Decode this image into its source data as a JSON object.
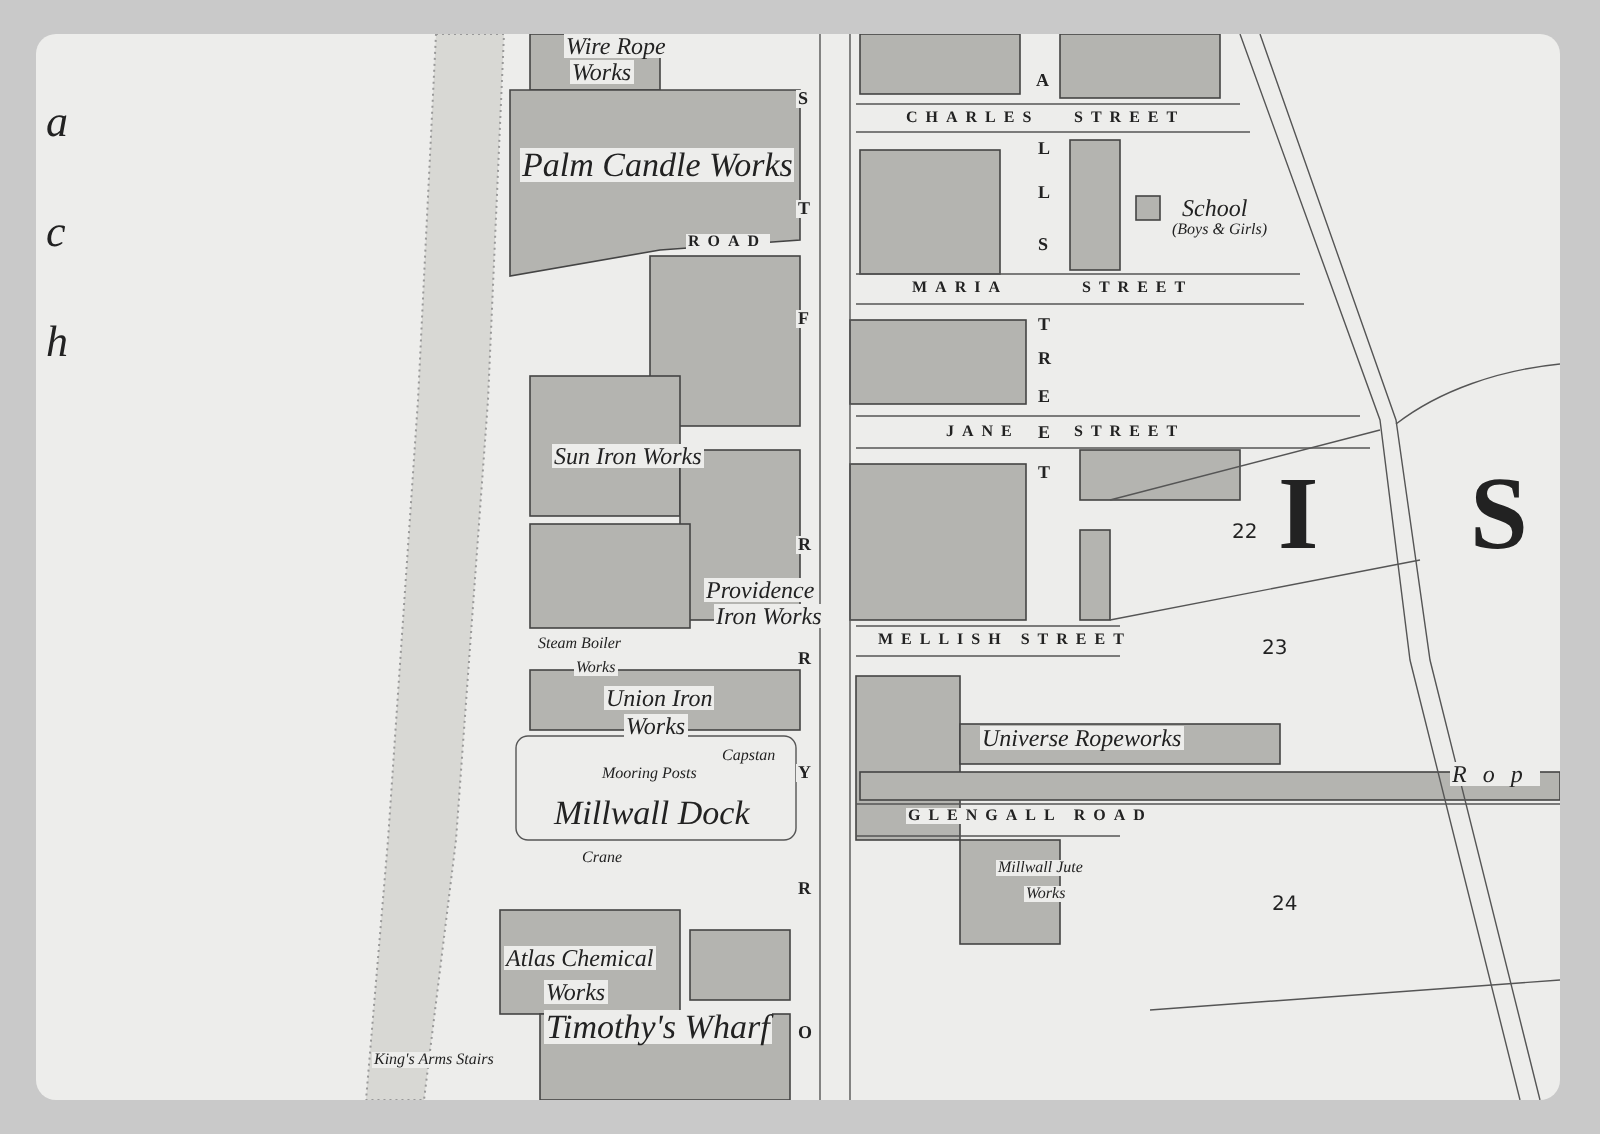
{
  "map": {
    "labels": [
      {
        "text": "a",
        "kind": "reach"
      },
      {
        "text": "c",
        "kind": "reach"
      },
      {
        "text": "h",
        "kind": "reach"
      },
      {
        "text": "Wire Rope",
        "kind": "works"
      },
      {
        "text": "Works",
        "kind": "works"
      },
      {
        "text": "S",
        "kind": "letter"
      },
      {
        "text": "A",
        "kind": "letter"
      },
      {
        "text": "CHARLES",
        "kind": "street"
      },
      {
        "text": "STREET",
        "kind": "street"
      },
      {
        "text": "Palm Candle Works",
        "kind": "works_large"
      },
      {
        "text": "L",
        "kind": "letter"
      },
      {
        "text": "L",
        "kind": "letter"
      },
      {
        "text": "School",
        "kind": "works"
      },
      {
        "text": "(Boys & Girls)",
        "kind": "note"
      },
      {
        "text": "T",
        "kind": "letter"
      },
      {
        "text": "ROAD",
        "kind": "street"
      },
      {
        "text": "S",
        "kind": "letter"
      },
      {
        "text": "MARIA",
        "kind": "street"
      },
      {
        "text": "STREET",
        "kind": "street"
      },
      {
        "text": "F",
        "kind": "letter"
      },
      {
        "text": "T",
        "kind": "letter"
      },
      {
        "text": "R",
        "kind": "letter"
      },
      {
        "text": "E",
        "kind": "letter"
      },
      {
        "text": "JANE",
        "kind": "street"
      },
      {
        "text": "E",
        "kind": "letter"
      },
      {
        "text": "STREET",
        "kind": "street"
      },
      {
        "text": "Sun Iron Works",
        "kind": "works"
      },
      {
        "text": "R",
        "kind": "letter"
      },
      {
        "text": "T",
        "kind": "letter"
      },
      {
        "text": "22",
        "kind": "number"
      },
      {
        "text": "I",
        "kind": "district"
      },
      {
        "text": "S",
        "kind": "district"
      },
      {
        "text": "Providence",
        "kind": "works"
      },
      {
        "text": "Iron Works",
        "kind": "works"
      },
      {
        "text": "Steam Boiler",
        "kind": "note"
      },
      {
        "text": "Works",
        "kind": "note"
      },
      {
        "text": "R",
        "kind": "letter"
      },
      {
        "text": "MELLISH STREET",
        "kind": "street"
      },
      {
        "text": "23",
        "kind": "number"
      },
      {
        "text": "Union Iron",
        "kind": "works"
      },
      {
        "text": "Works",
        "kind": "works"
      },
      {
        "text": "Capstan",
        "kind": "note"
      },
      {
        "text": "Universe Ropeworks",
        "kind": "works"
      },
      {
        "text": "Mooring Posts",
        "kind": "note"
      },
      {
        "text": "Y",
        "kind": "letter"
      },
      {
        "text": "Rop",
        "kind": "works_spaced"
      },
      {
        "text": "Millwall Dock",
        "kind": "works_large"
      },
      {
        "text": "GLENGALL ROAD",
        "kind": "street"
      },
      {
        "text": "Crane",
        "kind": "note"
      },
      {
        "text": "Millwall Jute",
        "kind": "note"
      },
      {
        "text": "R",
        "kind": "letter"
      },
      {
        "text": "Works",
        "kind": "note"
      },
      {
        "text": "24",
        "kind": "number"
      },
      {
        "text": "Atlas Chemical",
        "kind": "works"
      },
      {
        "text": "Works",
        "kind": "works"
      },
      {
        "text": "Timothy's Wharf",
        "kind": "works_large"
      },
      {
        "text": "O",
        "kind": "letter"
      },
      {
        "text": "King's Arms Stairs",
        "kind": "note"
      }
    ]
  }
}
